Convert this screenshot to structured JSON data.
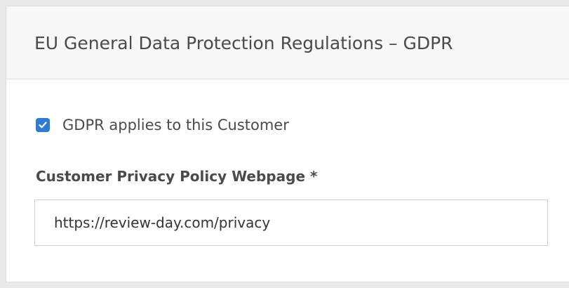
{
  "panel": {
    "title": "EU General Data Protection Regulations – GDPR"
  },
  "gdpr_checkbox": {
    "label": "GDPR applies to this Customer",
    "checked": true,
    "color": "#2f7bd3",
    "icon": "checkmark-icon"
  },
  "privacy_policy_field": {
    "label": "Customer Privacy Policy Webpage *",
    "value": "https://review-day.com/privacy"
  }
}
